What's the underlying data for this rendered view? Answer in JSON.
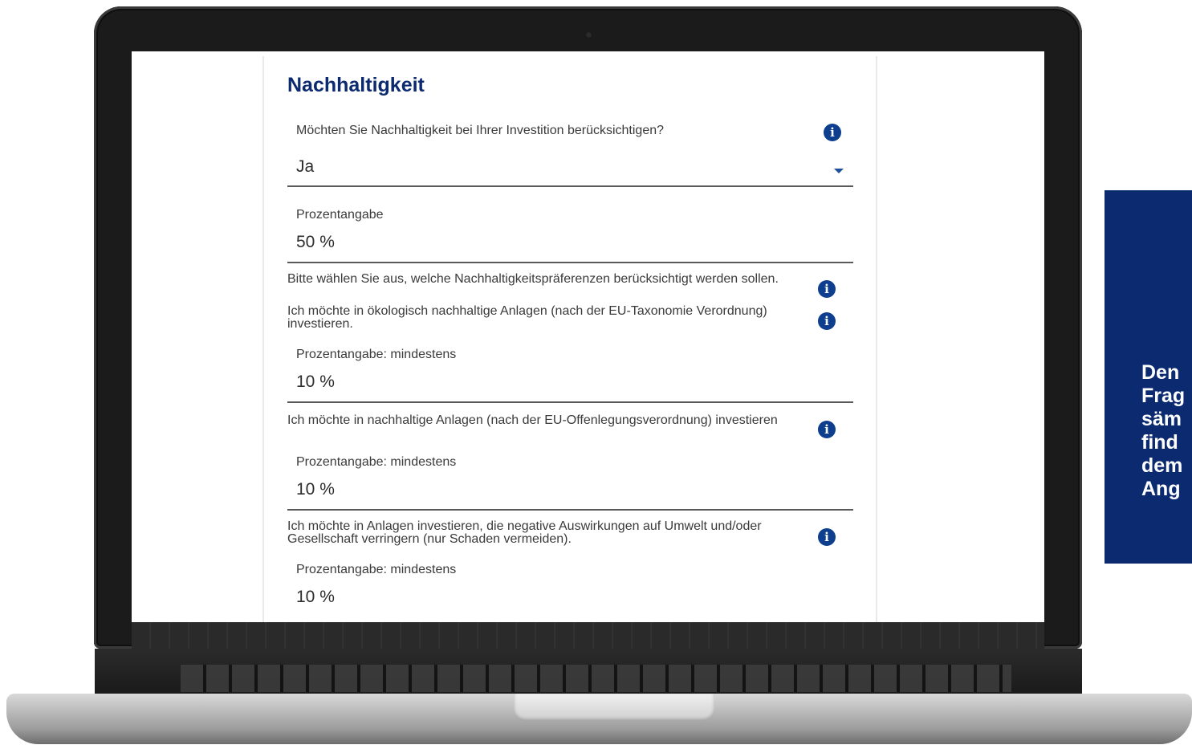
{
  "form": {
    "title": "Nachhaltigkeit",
    "q1": {
      "label": "Möchten Sie Nachhaltigkeit bei Ihrer Investition berücksichtigen?",
      "value": "Ja"
    },
    "q1_percent": {
      "label": "Prozentangabe",
      "value": "50 %"
    },
    "q2": {
      "label": "Bitte wählen Sie aus, welche Nachhaltigkeitspräferenzen berücksichtigt werden sollen.",
      "option": "Ich möchte in ökologisch nachhaltige Anlagen (nach der EU-Taxonomie Verordnung) investieren."
    },
    "q2_percent": {
      "label": "Prozentangabe: mindestens",
      "value": "10 %"
    },
    "q3": {
      "label": "Ich möchte in nachhaltige Anlagen (nach der EU-Offenlegungsverordnung) investieren"
    },
    "q3_percent": {
      "label": "Prozentangabe: mindestens",
      "value": "10 %"
    },
    "q4": {
      "label": "Ich möchte in Anlagen investieren, die negative Auswirkungen auf Umwelt und/oder Gesellschaft verringern (nur Schaden vermeiden)."
    },
    "q4_percent": {
      "label": "Prozentangabe: mindestens",
      "value": "10 %"
    }
  },
  "icons": {
    "info": "info-icon",
    "dropdown": "chevron-down-icon"
  },
  "callout": {
    "text": "Den\nFrag\nsäm\nfind\ndem\nAng"
  },
  "colors": {
    "brand": "#0b2a70",
    "icon": "#0d3f8e"
  }
}
